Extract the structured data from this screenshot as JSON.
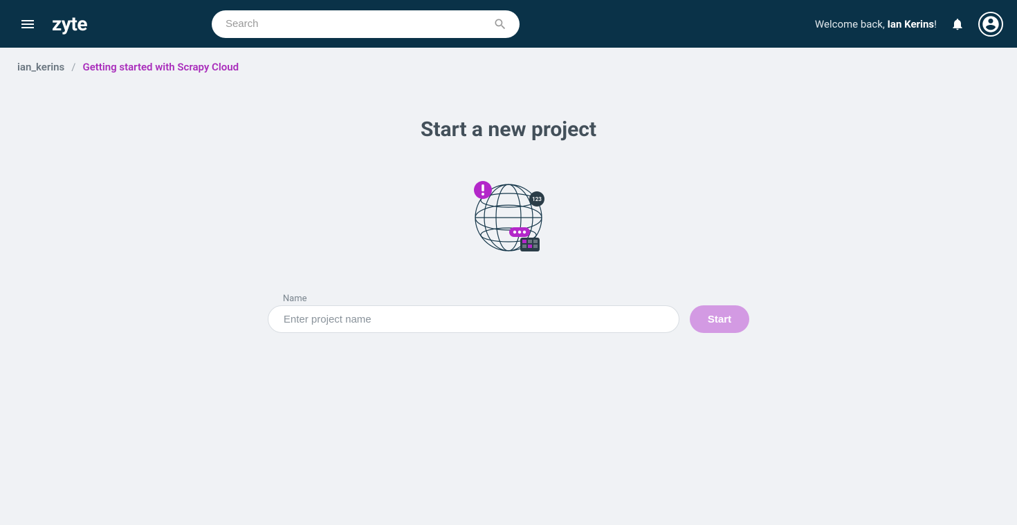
{
  "header": {
    "logo_text": "zyte",
    "search_placeholder": "Search",
    "welcome_prefix": "Welcome back, ",
    "welcome_name": "Ian Kerins",
    "welcome_suffix": "!"
  },
  "breadcrumb": {
    "root": "ian_kerins",
    "separator": "/",
    "current": "Getting started with Scrapy Cloud"
  },
  "main": {
    "title": "Start a new project",
    "name_label": "Name",
    "name_placeholder": "Enter project name",
    "start_button": "Start"
  },
  "illustration": {
    "badge_number": "123"
  },
  "colors": {
    "header_bg": "#0a3248",
    "accent": "#a92dbb",
    "button": "#d39ae3",
    "page_bg": "#f0f2f5"
  }
}
